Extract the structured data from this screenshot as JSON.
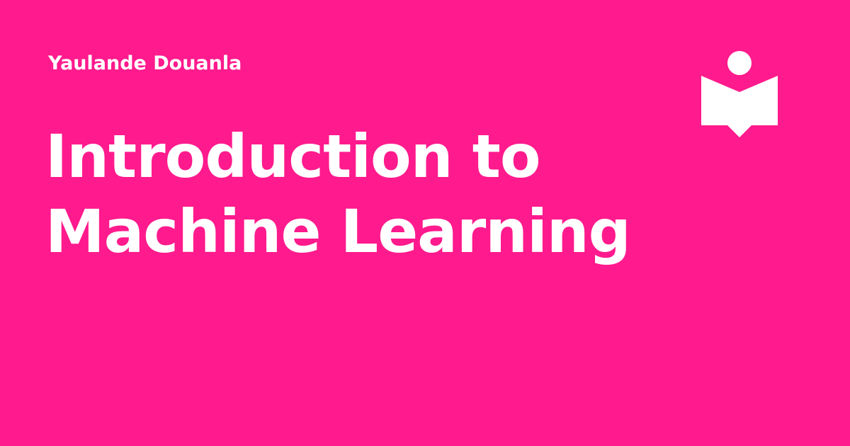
{
  "card": {
    "author": "Yaulande Douanla",
    "title_lines": [
      "Introduction to",
      "Machine Learning"
    ],
    "background_color": "#FF1A8D",
    "text_color": "#FFFFFF",
    "logo_icon": "reader-book-icon"
  }
}
